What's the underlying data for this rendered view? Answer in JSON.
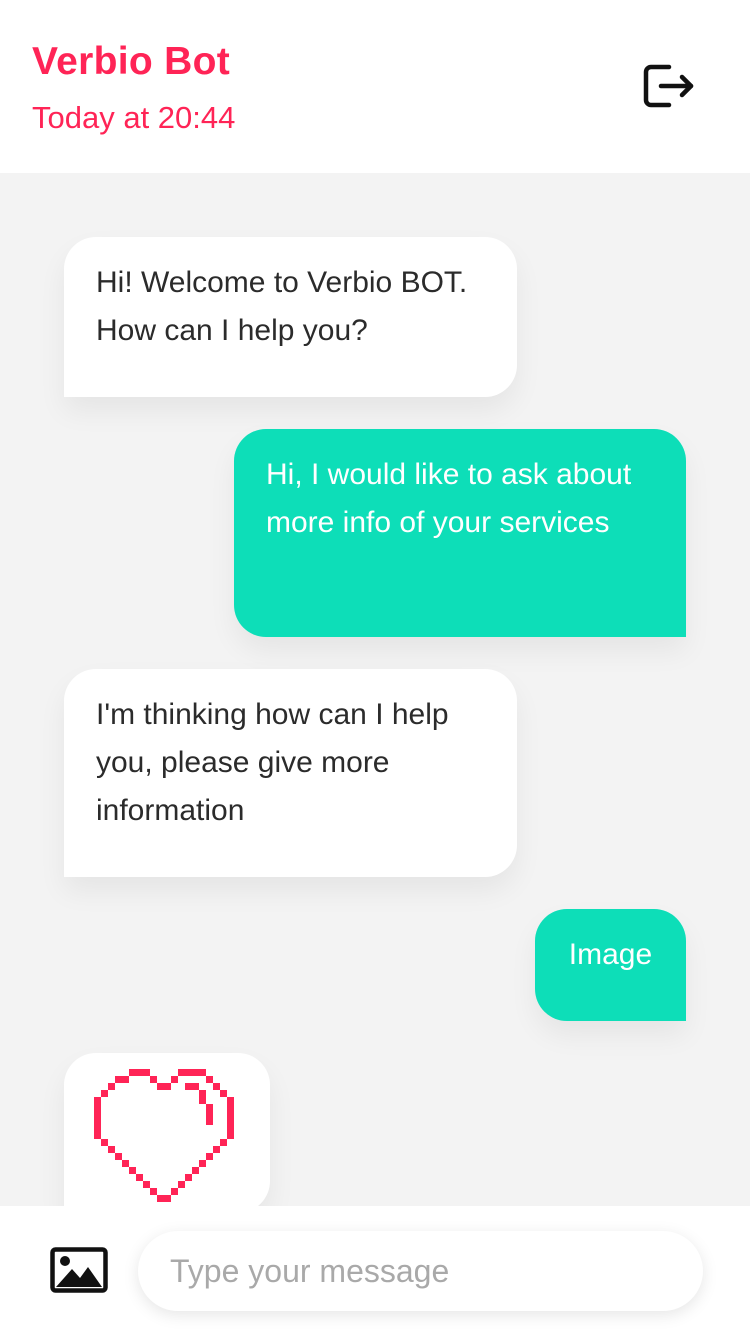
{
  "header": {
    "title": "Verbio Bot",
    "timestamp": "Today at 20:44",
    "logout_icon": "logout-icon"
  },
  "messages": [
    {
      "sender": "bot",
      "text": "Hi! Welcome to Verbio BOT. How can I help you?"
    },
    {
      "sender": "user",
      "text": "Hi, I would like to ask about more info of your services"
    },
    {
      "sender": "bot",
      "text": "I'm thinking how can I help you, please give more information"
    },
    {
      "sender": "user",
      "text": "Image"
    },
    {
      "sender": "bot",
      "type": "image",
      "image": "pixel-heart"
    }
  ],
  "composer": {
    "image_icon": "image-icon",
    "placeholder": "Type your message",
    "value": ""
  },
  "colors": {
    "accent": "#ff2456",
    "user_bubble": "#0ddeb8",
    "bot_bubble": "#ffffff",
    "background": "#f3f3f3"
  }
}
